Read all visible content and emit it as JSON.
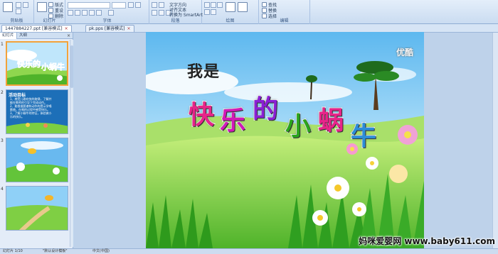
{
  "ribbon": {
    "groups": [
      {
        "label": "剪贴板"
      },
      {
        "label": "幻灯片"
      },
      {
        "label": "字体"
      },
      {
        "label": "段落"
      },
      {
        "label": "绘图"
      },
      {
        "label": "编辑"
      }
    ],
    "buttons": {
      "new_slide": "新建幻灯片",
      "layout": "版式",
      "reset": "重设",
      "delete": "删除",
      "text_direction": "文字方向",
      "align_text": "对齐文本",
      "convert_smartart": "转换为 SmartArt",
      "arrange": "排列",
      "quick_styles": "快速样式",
      "fill": "形状填充",
      "outline": "形状轮廓",
      "effects": "形状效果",
      "find": "查找",
      "replace": "替换",
      "select": "选择"
    }
  },
  "docbar": {
    "tabs": [
      {
        "label": "1447884227.ppt [兼容模式]",
        "active": true
      },
      {
        "label": "pk.pps [兼容模式]",
        "active": false
      }
    ]
  },
  "panel": {
    "tabs": [
      {
        "label": "幻灯片",
        "active": true
      },
      {
        "label": "大纲",
        "active": false
      }
    ],
    "close": "×",
    "thumbs": [
      {
        "num": "1"
      },
      {
        "num": "2",
        "heading": "活动目标",
        "lines": [
          "1、感受儿歌欢快的旋律，了解并",
          "能在教师的引导下完成动作。",
          "2、能根据图谱和动作的提示学唱",
          "歌曲，在唱的过程中感受快乐。",
          "3、了解小蜗牛的特征，体验做小",
          "乐的快乐。"
        ]
      },
      {
        "num": "3"
      },
      {
        "num": "4"
      }
    ]
  },
  "slide": {
    "pre_title": "我是",
    "title_chars": [
      "快",
      "乐",
      "的",
      "小",
      "蜗",
      "牛"
    ],
    "title_colors": [
      "#e8248a",
      "#d318b8",
      "#8a1fd6",
      "#2aa51c",
      "#e8248a",
      "#2c8ed8"
    ],
    "corner_logo": "优酷"
  },
  "watermark": {
    "site": "妈咪爱婴网 www.baby611.com"
  },
  "status": {
    "slide_info": "幻灯片 1/10",
    "theme": "\"默认设计模板\"",
    "language": "中文(中国)"
  }
}
